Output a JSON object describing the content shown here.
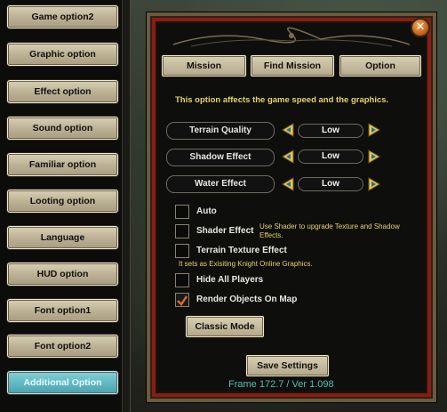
{
  "left_menu": {
    "items": [
      {
        "label": "Game option2"
      },
      {
        "label": "Graphic option"
      },
      {
        "label": "Effect option"
      },
      {
        "label": "Sound option"
      },
      {
        "label": "Familiar option"
      },
      {
        "label": "Looting option"
      },
      {
        "label": "Language"
      },
      {
        "label": "HUD option"
      },
      {
        "label": "Font option1"
      },
      {
        "label": "Font option2"
      },
      {
        "label": "Additional Option"
      }
    ],
    "active_index": 10
  },
  "window": {
    "close_label": "✕",
    "tabs": [
      {
        "label": "Mission"
      },
      {
        "label": "Find Mission"
      },
      {
        "label": "Option"
      }
    ],
    "info_text": "This option affects the game speed and the graphics.",
    "settings": [
      {
        "label": "Terrain Quality",
        "value": "Low"
      },
      {
        "label": "Shadow Effect",
        "value": "Low"
      },
      {
        "label": "Water Effect",
        "value": "Low"
      }
    ],
    "checkboxes": [
      {
        "label": "Auto",
        "checked": false
      },
      {
        "label": "Shader Effect",
        "checked": false,
        "description": "Use Shader to upgrade Texture and Shadow Effects."
      },
      {
        "label": "Terrain Texture Effect",
        "checked": false,
        "description": "It sets as Exisiting Knight Online Graphics."
      },
      {
        "label": "Hide All Players",
        "checked": false
      },
      {
        "label": "Render Objects On Map",
        "checked": true
      }
    ],
    "classic_mode_label": "Classic Mode",
    "save_label": "Save Settings",
    "frame_text": "Frame 172.7 / Ver 1.098"
  },
  "colors": {
    "accent_text": "#e6d36a",
    "check_mark": "#e06a2a",
    "frame_text": "#4fbfb6",
    "arrow": "#e8c84a",
    "frame_border": "#8a1c12"
  }
}
